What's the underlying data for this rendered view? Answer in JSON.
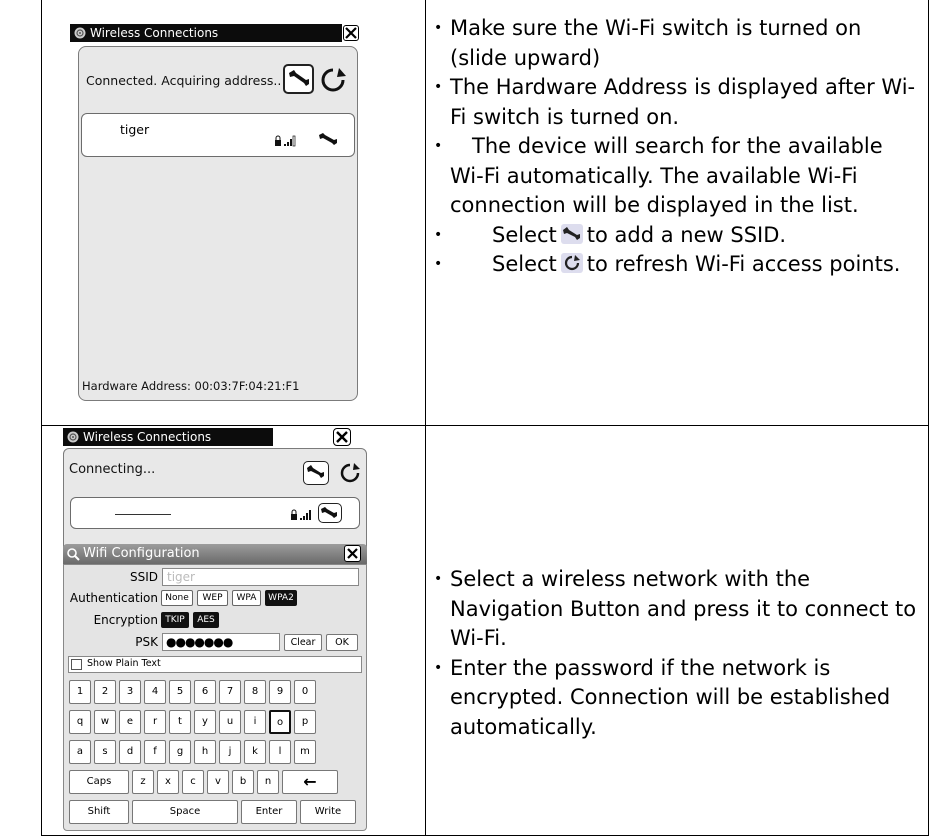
{
  "row1": {
    "window": {
      "title": "Wireless Connections",
      "status": "Connected. Acquiring address..",
      "network_name": "tiger",
      "hardware_address": "Hardware Address: 00:03:7F:04:21:F1"
    },
    "bullets": [
      "Make sure the Wi-Fi switch is turned on (slide upward)",
      "The Hardware Address is displayed after Wi-Fi switch is turned on.",
      "The device will search for the available Wi-Fi automatically. The available Wi-Fi connection will be displayed in the list."
    ],
    "bullet4_pre": "Select",
    "bullet4_post": "to add a new SSID.",
    "bullet5_pre": "Select",
    "bullet5_post": "to refresh Wi-Fi access points."
  },
  "row2": {
    "window": {
      "title": "Wireless Connections",
      "status": "Connecting..."
    },
    "config": {
      "title": "Wifi Configuration",
      "ssid_label": "SSID",
      "ssid_value": "tiger",
      "auth_label": "Authentication",
      "auth_options": [
        "None",
        "WEP",
        "WPA",
        "WPA2"
      ],
      "enc_label": "Encryption",
      "enc_options": [
        "TKIP",
        "AES"
      ],
      "psk_label": "PSK",
      "psk_value": "●●●●●●●",
      "clear_label": "Clear",
      "ok_label": "OK",
      "show_plain_label": "Show Plain Text",
      "keys_row1": [
        "1",
        "2",
        "3",
        "4",
        "5",
        "6",
        "7",
        "8",
        "9",
        "0"
      ],
      "keys_row2": [
        "q",
        "w",
        "e",
        "r",
        "t",
        "y",
        "u",
        "i",
        "o",
        "p"
      ],
      "keys_row3": [
        "a",
        "s",
        "d",
        "f",
        "g",
        "h",
        "j",
        "k",
        "l",
        "m"
      ],
      "keys_row4": [
        "Caps",
        "z",
        "x",
        "c",
        "v",
        "b",
        "n",
        "←"
      ],
      "keys_row5": [
        "Shift",
        "Space",
        "Enter",
        "Write"
      ]
    },
    "bullets": [
      "Select a wireless network with the Navigation Button and press it to connect to Wi-Fi.",
      "Enter the password if the network is encrypted. Connection will be established automatically."
    ]
  }
}
